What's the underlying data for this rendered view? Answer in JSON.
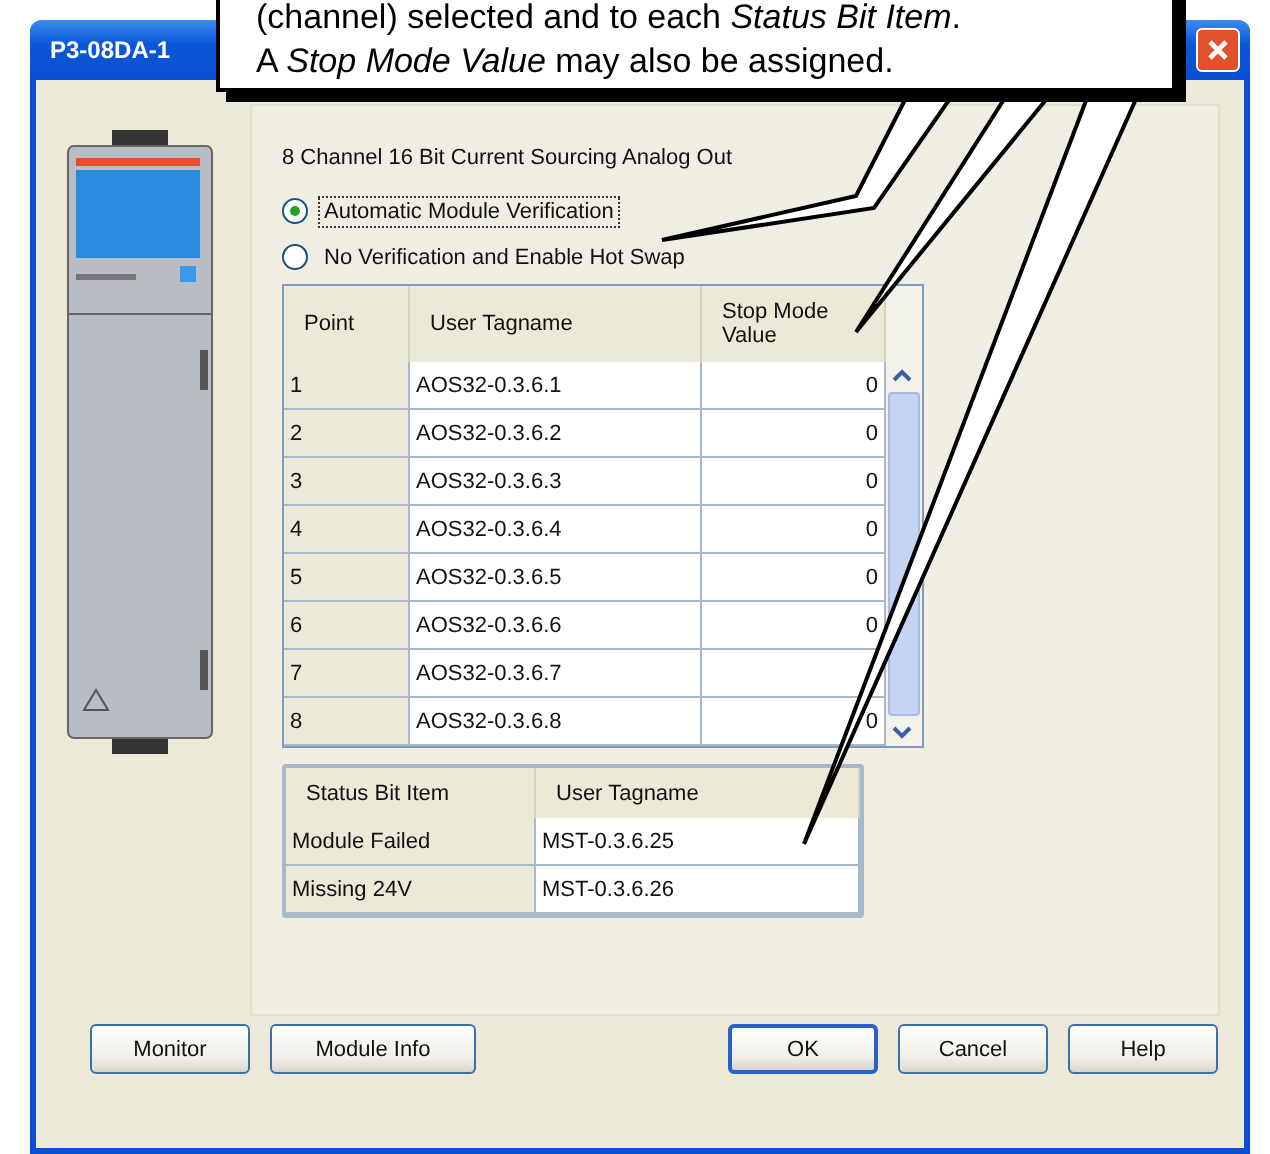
{
  "window": {
    "title": "P3-08DA-1"
  },
  "callout": {
    "lines": [
      "(channel) selected and to each *Status Bit Item*.",
      "A *Stop Mode Value* may also be assigned."
    ]
  },
  "module_description": "8 Channel 16 Bit Current Sourcing Analog Out",
  "verification_options": [
    {
      "label": "Automatic Module Verification",
      "selected": true
    },
    {
      "label": "No Verification and Enable Hot Swap",
      "selected": false
    }
  ],
  "points_table": {
    "columns": [
      "Point",
      "User Tagname",
      "Stop Mode Value"
    ],
    "rows": [
      {
        "point": "1",
        "user_tagname": "AOS32-0.3.6.1",
        "stop_mode_value": "0"
      },
      {
        "point": "2",
        "user_tagname": "AOS32-0.3.6.2",
        "stop_mode_value": "0"
      },
      {
        "point": "3",
        "user_tagname": "AOS32-0.3.6.3",
        "stop_mode_value": "0"
      },
      {
        "point": "4",
        "user_tagname": "AOS32-0.3.6.4",
        "stop_mode_value": "0"
      },
      {
        "point": "5",
        "user_tagname": "AOS32-0.3.6.5",
        "stop_mode_value": "0"
      },
      {
        "point": "6",
        "user_tagname": "AOS32-0.3.6.6",
        "stop_mode_value": "0"
      },
      {
        "point": "7",
        "user_tagname": "AOS32-0.3.6.7"
      },
      {
        "point": "8",
        "user_tagname": "AOS32-0.3.6.8",
        "stop_mode_value": "0"
      }
    ]
  },
  "status_table": {
    "columns": [
      "Status Bit Item",
      "User Tagname"
    ],
    "rows": [
      {
        "status_bit_item": "Module Failed",
        "user_tagname": "MST-0.3.6.25"
      },
      {
        "status_bit_item": "Missing 24V",
        "user_tagname": "MST-0.3.6.26"
      }
    ]
  },
  "buttons_left": [
    {
      "label": "Monitor",
      "default": false
    },
    {
      "label": "Module Info",
      "default": false
    }
  ],
  "buttons_right": [
    {
      "label": "OK",
      "default": true
    },
    {
      "label": "Cancel",
      "default": false
    },
    {
      "label": "Help",
      "default": false
    }
  ]
}
